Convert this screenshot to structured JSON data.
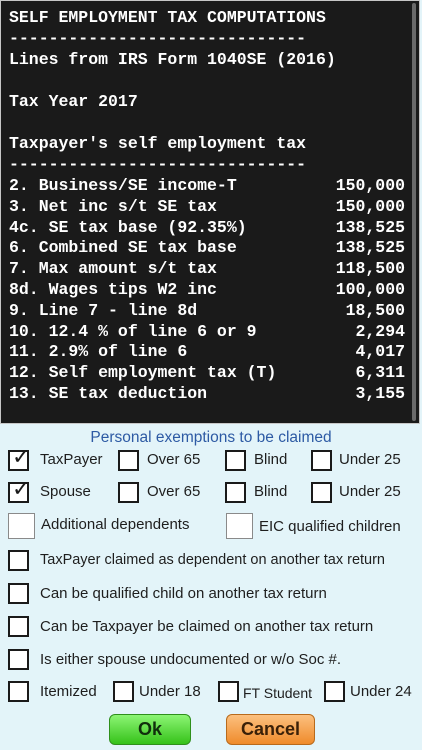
{
  "terminal": {
    "title": "SELF EMPLOYMENT TAX COMPUTATIONS",
    "divider1": "------------------------------",
    "source": "Lines from IRS Form 1040SE (2016)",
    "tax_year": "Tax Year 2017",
    "section": "Taxpayer's self employment tax",
    "divider2": "------------------------------",
    "lines": [
      {
        "label": "2. Business/SE income-T",
        "value": "150,000"
      },
      {
        "label": "3. Net inc s/t SE tax",
        "value": "150,000"
      },
      {
        "label": "4c. SE tax base (92.35%)",
        "value": "138,525"
      },
      {
        "label": "6. Combined SE tax base",
        "value": "138,525"
      },
      {
        "label": "7. Max amount s/t tax",
        "value": "118,500"
      },
      {
        "label": "8d. Wages tips W2 inc",
        "value": "100,000"
      },
      {
        "label": "9. Line 7 - line 8d",
        "value": "18,500"
      },
      {
        "label": "10. 12.4 % of line 6 or 9",
        "value": "2,294"
      },
      {
        "label": "11. 2.9% of line 6",
        "value": "4,017"
      },
      {
        "label": "12. Self employment tax (T)",
        "value": "6,311"
      },
      {
        "label": "13. SE tax deduction",
        "value": "3,155"
      }
    ]
  },
  "form": {
    "header": "Personal exemptions to be claimed",
    "row1": {
      "taxpayer": "TaxPayer",
      "over65": "Over 65",
      "blind": "Blind",
      "under25": "Under 25",
      "taxpayer_checked": true
    },
    "row2": {
      "spouse": "Spouse",
      "over65": "Over 65",
      "blind": "Blind",
      "under25": "Under 25",
      "spouse_checked": true
    },
    "additional_dependents": "Additional dependents",
    "eic_children": "EIC qualified children",
    "claimed_dependent": "TaxPayer claimed as dependent on another tax return",
    "qualified_child": "Can be qualified child on another tax return",
    "taxpayer_claimed": "Can be Taxpayer be claimed on another tax return",
    "undocumented": "Is either spouse undocumented or w/o Soc #.",
    "itemized": "Itemized",
    "under18": "Under 18",
    "ft_student": "FT Student",
    "under24": "Under 24",
    "check_glyph": "✓",
    "ok_label": "Ok",
    "cancel_label": "Cancel"
  }
}
